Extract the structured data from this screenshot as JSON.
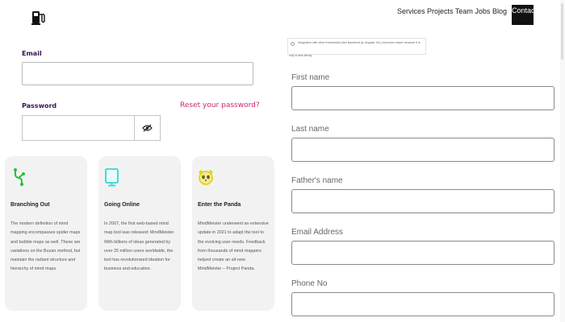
{
  "nav": {
    "items": [
      "Services",
      "Projects",
      "Team",
      "Jobs",
      "Blog"
    ],
    "contact": "Contact"
  },
  "login": {
    "email_label": "Email",
    "email_value": "",
    "password_label": "Password",
    "reset_link": "Reset your password?",
    "password_value": ""
  },
  "cards": [
    {
      "icon": "branch-icon",
      "title": "Branching Out",
      "body": "The modern definition of mind mapping encompasses spider maps and bubble maps as well. These are variations on the Buzan method, but maintain the radiant structure and hierarchy of mind maps."
    },
    {
      "icon": "monitor-icon",
      "title": "Going Online",
      "body": "In 2007, the first web-based mind map tool was released: MindMeister. With billions of ideas generated by over 25 million users worldwide, the tool has revolutionized ideation for business and education."
    },
    {
      "icon": "panda-icon",
      "title": "Enter the Panda",
      "body": "MindMeister underwent an extensive update in 2021 to adapt the tool to the evolving user needs. Feedback from thousands of mind mappers helped create an all-new MindMeister – Project Panda."
    }
  ],
  "notice": {
    "text": "Integration with other frameworks (like Backbone.js, Angular, etc.) becomes easier because it is",
    "tail": "only a view library"
  },
  "form": {
    "fields": [
      {
        "label": "First name",
        "value": ""
      },
      {
        "label": "Last name",
        "value": ""
      },
      {
        "label": "Father's name",
        "value": ""
      },
      {
        "label": "Email Address",
        "value": ""
      },
      {
        "label": "Phone No",
        "value": ""
      }
    ]
  },
  "colors": {
    "label_purple": "#3a1452",
    "link_pink": "#d22275",
    "card_bg": "#f2f2f2",
    "branch_green": "#26c13c",
    "monitor_cyan": "#36d6d6",
    "panda_yellow": "#e8d21a"
  }
}
